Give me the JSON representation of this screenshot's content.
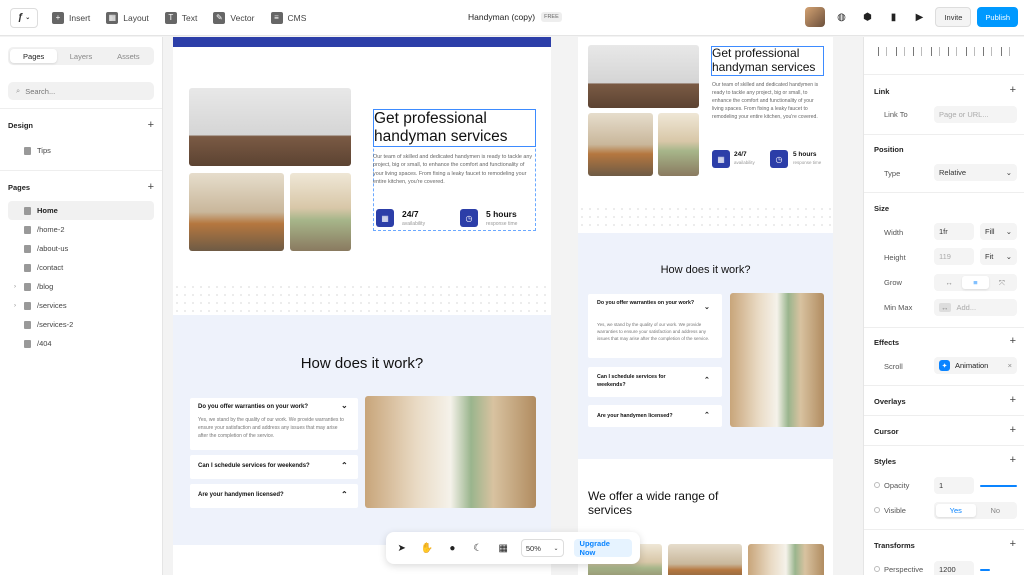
{
  "toolbar": {
    "logo_icon": "framer-logo-icon",
    "items": [
      {
        "label": "Insert",
        "icon": "plus-icon"
      },
      {
        "label": "Layout",
        "icon": "layout-icon"
      },
      {
        "label": "Text",
        "icon": "text-icon"
      },
      {
        "label": "Vector",
        "icon": "pen-icon"
      },
      {
        "label": "CMS",
        "icon": "database-icon"
      }
    ],
    "doc_title": "Handyman (copy)",
    "plan_badge": "FREE",
    "invite_label": "Invite",
    "publish_label": "Publish"
  },
  "left_panel": {
    "tabs": [
      "Pages",
      "Layers",
      "Assets"
    ],
    "active_tab": "Pages",
    "search_placeholder": "Search...",
    "design_title": "Design",
    "design_items": [
      "Tips"
    ],
    "pages_title": "Pages",
    "pages": [
      {
        "label": "Home",
        "active": true
      },
      {
        "label": "/home-2"
      },
      {
        "label": "/about-us"
      },
      {
        "label": "/contact"
      },
      {
        "label": "/blog",
        "collapsible": true
      },
      {
        "label": "/services",
        "collapsible": true
      },
      {
        "label": "/services-2"
      },
      {
        "label": "/404"
      }
    ]
  },
  "canvas": {
    "hero": {
      "heading": "Get professional handyman services",
      "paragraph": "Our team of skilled and dedicated handymen is ready to tackle any project, big or small, to enhance the comfort and functionality of your living spaces. From fixing a leaky faucet to remodeling your entire kitchen, you're covered.",
      "stats": [
        {
          "value": "24/7",
          "label": "availability",
          "icon": "calendar-icon"
        },
        {
          "value": "5 hours",
          "label": "response time",
          "icon": "clock-icon"
        }
      ]
    },
    "how": {
      "title": "How does it work?",
      "faqs": [
        {
          "q": "Do you offer warranties on your work?",
          "a": "Yes, we stand by the quality of our work. We provide warranties to ensure your satisfaction and address any issues that may arise after the completion of the service.",
          "open": true
        },
        {
          "q": "Can I schedule services for weekends?",
          "open": false
        },
        {
          "q": "Are your handymen licensed?",
          "open": false
        }
      ]
    },
    "services_title": "We offer a wide range of services"
  },
  "float_tools": {
    "icons": [
      "cursor-icon",
      "hand-icon",
      "comment-icon",
      "moon-icon",
      "grid-icon"
    ],
    "zoom": "50%",
    "upgrade_label": "Upgrade Now"
  },
  "right_panel": {
    "link": {
      "title": "Link",
      "label": "Link To",
      "placeholder": "Page or URL..."
    },
    "position": {
      "title": "Position",
      "label": "Type",
      "value": "Relative"
    },
    "size": {
      "title": "Size",
      "width_label": "Width",
      "width_value": "1fr",
      "width_mode": "Fill",
      "height_label": "Height",
      "height_value": "119",
      "height_mode": "Fit",
      "grow_label": "Grow",
      "minmax_label": "Min Max",
      "minmax_placeholder": "Add..."
    },
    "effects": {
      "title": "Effects",
      "scroll_label": "Scroll",
      "scroll_value": "Animation"
    },
    "overlays": {
      "title": "Overlays"
    },
    "cursor": {
      "title": "Cursor"
    },
    "styles": {
      "title": "Styles",
      "opacity_label": "Opacity",
      "opacity_value": "1",
      "visible_label": "Visible",
      "visible_yes": "Yes",
      "visible_no": "No"
    },
    "transforms": {
      "title": "Transforms",
      "perspective_label": "Perspective",
      "perspective_value": "1200"
    }
  },
  "colors": {
    "accent": "#0099ff",
    "brand_blue": "#2c3ea8",
    "section_bg": "#eef2fb"
  }
}
